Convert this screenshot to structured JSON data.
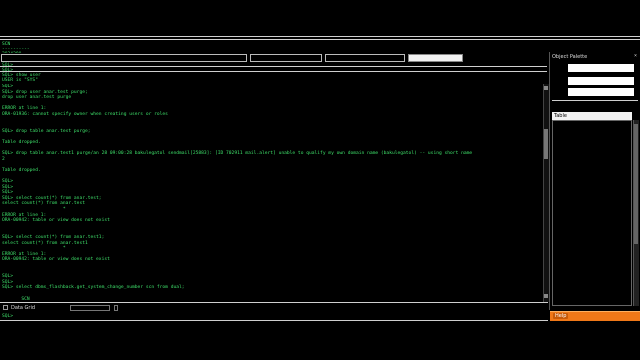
{
  "top_output": {
    "header": "SCN",
    "separator": "----------",
    "value": "2034290"
  },
  "toolbar_prompts": [
    "SQL>",
    "SQL>",
    "SQL> show user",
    "USER is \"SYS\""
  ],
  "object_palette": {
    "title": "Object Palette",
    "table_label": "Table"
  },
  "terminal_lines": [
    "SQL>",
    "SQL> drop user anar.test purge;",
    "drop user anar.test purge",
    "",
    "ERROR at line 1:",
    "ORA-01936: cannot specify owner when creating users or roles",
    "",
    "",
    "SQL> drop table anar.test purge;",
    "",
    "Table dropped.",
    "",
    "SQL> drop table anar.test1 purge/an 28 09:00:28 bakulegatol sendmail[25883]: [ID 702911 mail.alert] unable to qualify my own domain name (bakulegatol) -- using short name",
    "2",
    "",
    "Table dropped.",
    "",
    "SQL>",
    "SQL>",
    "SQL>",
    "SQL> select count(*) from anar.test;",
    "select count(*) from anar.test",
    "                      *",
    "ERROR at line 1:",
    "ORA-00942: table or view does not exist",
    "",
    "",
    "SQL> select count(*) from anar.test1;",
    "select count(*) from anar.test1",
    "                      *",
    "ERROR at line 1:",
    "ORA-00942: table or view does not exist",
    "",
    "",
    "SQL>",
    "SQL>",
    "SQL> select dbms_flashback.get_system_change_number scn from dual;",
    "",
    "       SCN",
    "----------"
  ],
  "bottom": {
    "tab_label": "Data Grid",
    "prompt": "SQL>",
    "status_badge": "Help"
  },
  "colors": {
    "terminal_text": "#3ee06a",
    "status_accent": "#f07818"
  }
}
